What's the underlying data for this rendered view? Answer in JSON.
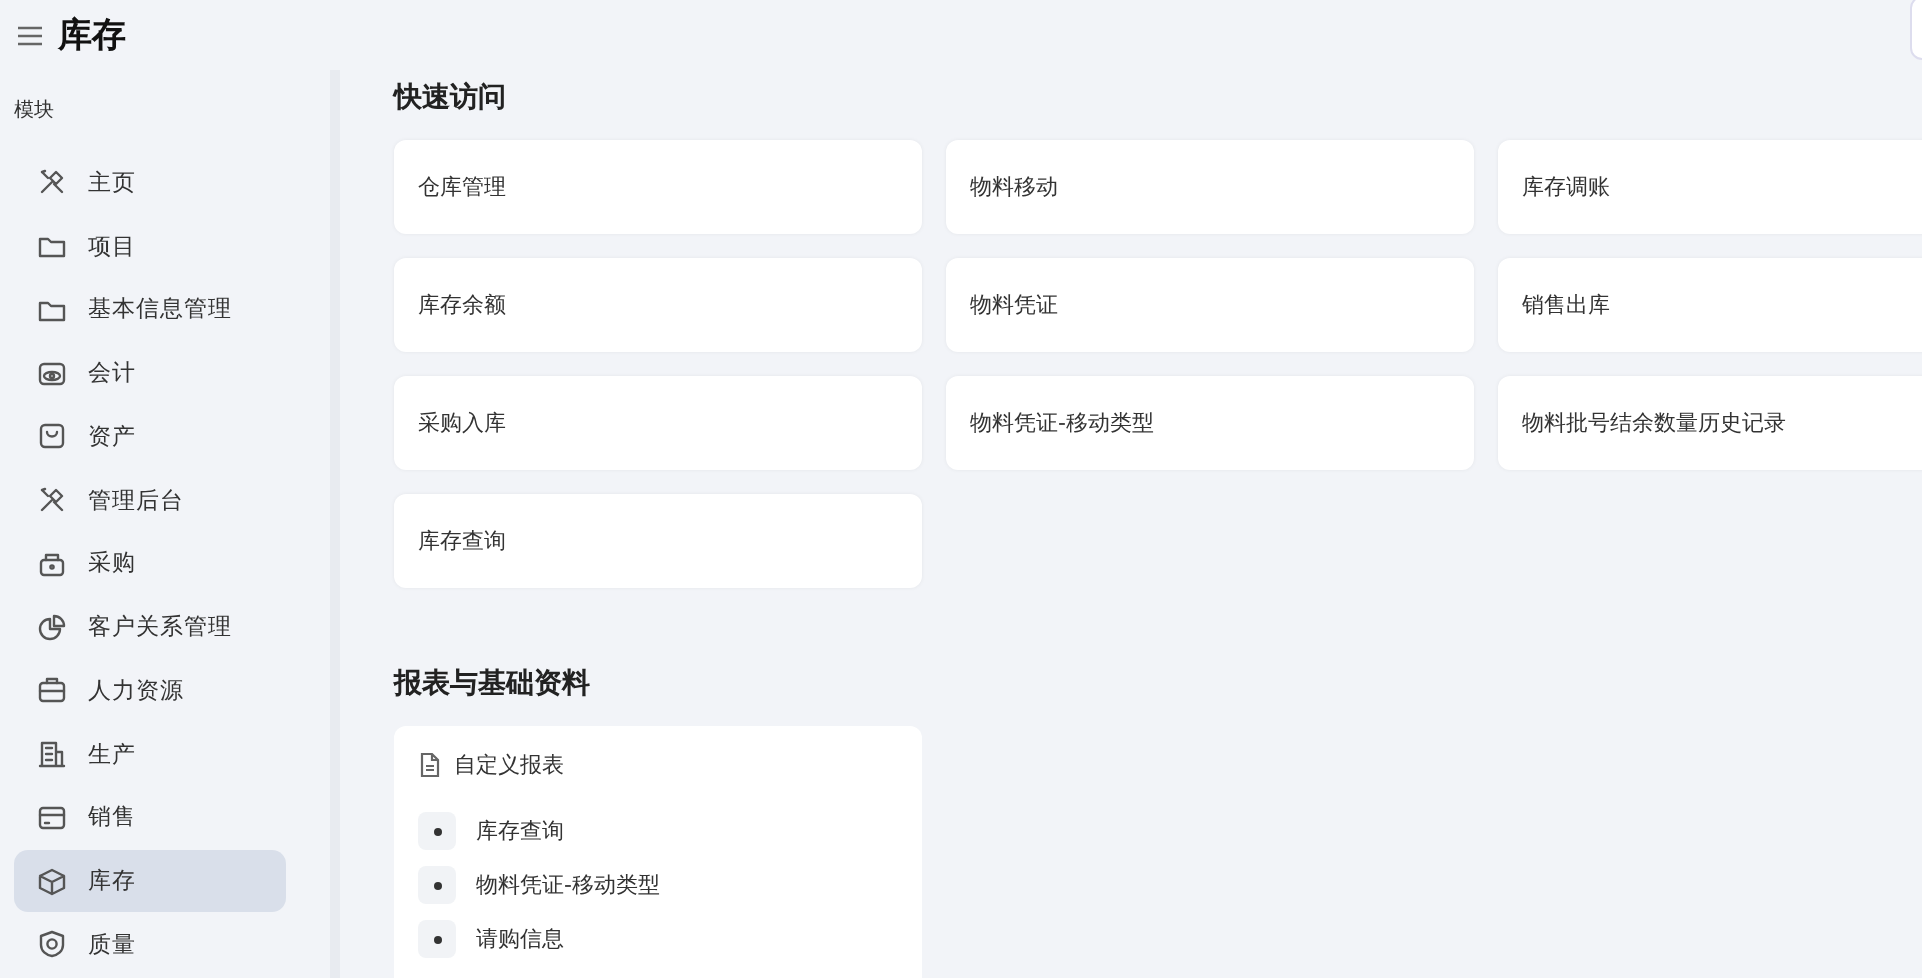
{
  "header": {
    "title": "库存"
  },
  "sidebar": {
    "heading": "模块",
    "items": [
      {
        "label": "主页",
        "selected": false
      },
      {
        "label": "项目",
        "selected": false
      },
      {
        "label": "基本信息管理",
        "selected": false
      },
      {
        "label": "会计",
        "selected": false
      },
      {
        "label": "资产",
        "selected": false
      },
      {
        "label": "管理后台",
        "selected": false
      },
      {
        "label": "采购",
        "selected": false
      },
      {
        "label": "客户关系管理",
        "selected": false
      },
      {
        "label": "人力资源",
        "selected": false
      },
      {
        "label": "生产",
        "selected": false
      },
      {
        "label": "销售",
        "selected": false
      },
      {
        "label": "库存",
        "selected": true
      },
      {
        "label": "质量",
        "selected": false
      }
    ]
  },
  "quick_access": {
    "title": "快速访问",
    "links": [
      "仓库管理",
      "物料移动",
      "库存调账",
      "库存余额",
      "物料凭证",
      "销售出库",
      "采购入库",
      "物料凭证-移动类型",
      "物料批号结余数量历史记录",
      "库存查询"
    ]
  },
  "reports": {
    "title": "报表与基础资料",
    "cards": [
      {
        "title": "自定义报表",
        "items": [
          "库存查询",
          "物料凭证-移动类型",
          "请购信息"
        ]
      }
    ]
  }
}
